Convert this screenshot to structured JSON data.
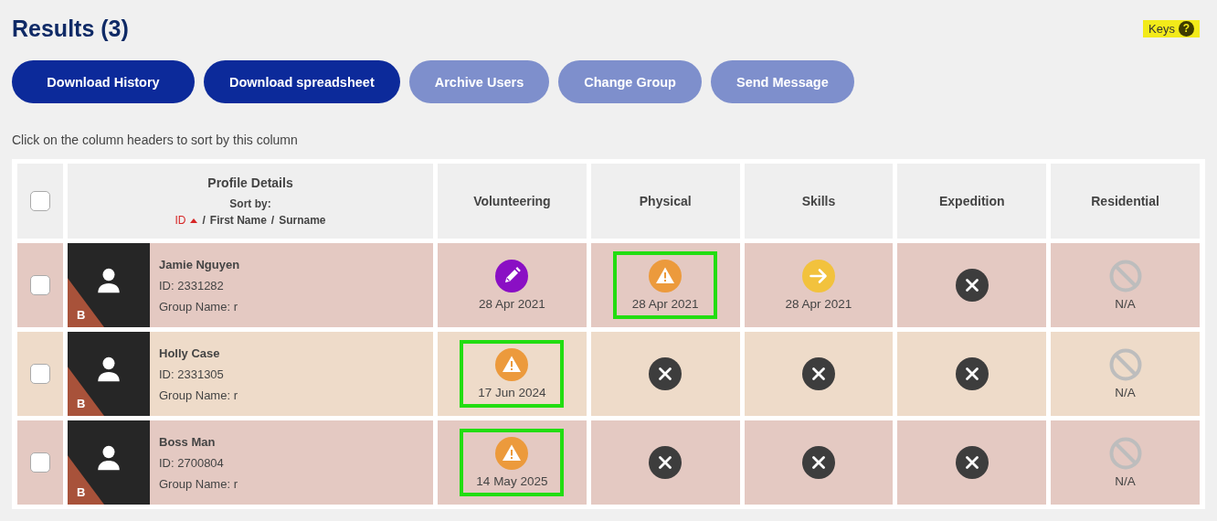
{
  "title": "Results (3)",
  "keys": {
    "label": "Keys",
    "icon": "?"
  },
  "buttons": [
    {
      "label": "Download History",
      "disabled": false
    },
    {
      "label": "Download spreadsheet",
      "disabled": false
    },
    {
      "label": "Archive Users",
      "disabled": true
    },
    {
      "label": "Change Group",
      "disabled": true
    },
    {
      "label": "Send Message",
      "disabled": true
    }
  ],
  "hint": "Click on the column headers to sort by this column",
  "table": {
    "select_all": {
      "checked": false
    },
    "profile_header": {
      "label": "Profile Details",
      "sort_label": "Sort by:",
      "separator": "/",
      "sort_options": [
        {
          "label": "ID",
          "selected": true
        },
        {
          "label": "First Name",
          "selected": false
        },
        {
          "label": "Surname",
          "selected": false
        }
      ]
    },
    "columns": [
      "Volunteering",
      "Physical",
      "Skills",
      "Expedition",
      "Residential"
    ],
    "rows": [
      {
        "checked": false,
        "color": "#e4c9c2",
        "name": "Jamie Nguyen",
        "id": "ID: 2331282",
        "group": "Group Name: r",
        "badge": "B",
        "cells": [
          {
            "kind": "edit",
            "date": "28 Apr 2021",
            "highlighted": false
          },
          {
            "kind": "warning",
            "date": "28 Apr 2021",
            "highlighted": true
          },
          {
            "kind": "next",
            "date": "28 Apr 2021",
            "highlighted": false
          },
          {
            "kind": "none",
            "highlighted": false
          },
          {
            "kind": "na",
            "date": "N/A",
            "highlighted": false
          }
        ]
      },
      {
        "checked": false,
        "color": "#eedbc9",
        "name": "Holly Case",
        "id": "ID: 2331305",
        "group": "Group Name: r",
        "badge": "B",
        "cells": [
          {
            "kind": "warning",
            "date": "17 Jun 2024",
            "highlighted": true
          },
          {
            "kind": "none",
            "highlighted": false
          },
          {
            "kind": "none",
            "highlighted": false
          },
          {
            "kind": "none",
            "highlighted": false
          },
          {
            "kind": "na",
            "date": "N/A",
            "highlighted": false
          }
        ]
      },
      {
        "checked": false,
        "color": "#e4c9c2",
        "name": "Boss Man",
        "id": "ID: 2700804",
        "group": "Group Name: r",
        "badge": "B",
        "cells": [
          {
            "kind": "warning",
            "date": "14 May 2025",
            "highlighted": true
          },
          {
            "kind": "none",
            "highlighted": false
          },
          {
            "kind": "none",
            "highlighted": false
          },
          {
            "kind": "none",
            "highlighted": false
          },
          {
            "kind": "na",
            "date": "N/A",
            "highlighted": false
          }
        ]
      }
    ]
  }
}
